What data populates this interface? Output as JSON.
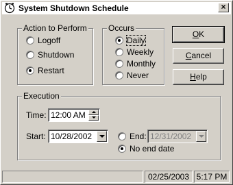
{
  "window": {
    "title": "System Shutdown Schedule",
    "close_glyph": "×"
  },
  "action_group": {
    "legend": "Action to Perform",
    "options": [
      "Logoff",
      "Shutdown",
      "Restart"
    ],
    "selected": "Restart"
  },
  "occurs_group": {
    "legend": "Occurs",
    "options": [
      "Daily",
      "Weekly",
      "Monthly",
      "Never"
    ],
    "selected": "Daily"
  },
  "buttons": {
    "ok": {
      "access": "O",
      "rest": "K"
    },
    "cancel": {
      "access": "C",
      "rest": "ancel"
    },
    "help": {
      "access": "H",
      "rest": "elp"
    }
  },
  "execution": {
    "legend": "Execution",
    "time_label": "Time:",
    "time_value": "12:00 AM",
    "start_label": "Start:",
    "start_value": "10/28/2002",
    "end_label": "End:",
    "end_value": "12/31/2002",
    "no_end_label": "No end date",
    "end_mode": "No end date"
  },
  "status": {
    "date": "02/25/2003",
    "time": "5:17 PM"
  }
}
